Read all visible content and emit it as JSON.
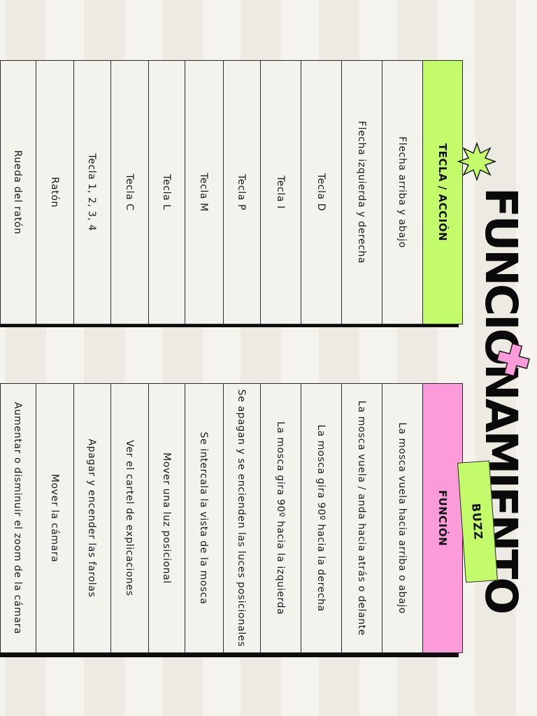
{
  "title": "FUNCIONAMIENTO",
  "tag": "BUZZ",
  "keys_table": {
    "header": "TECLA / ACCIÓN",
    "rows": [
      "Flecha arriba y abajo",
      "Flecha izquierda y derecha",
      "Tecla D",
      "Tecla I",
      "Tecla P",
      "Tecla M",
      "Tecla L",
      "Tecla C",
      "Tecla 1, 2, 3, 4",
      "Ratón",
      "Rueda del ratón"
    ]
  },
  "functions_table": {
    "header": "FUNCIÓN",
    "rows": [
      "La mosca vuela hacia arriba o abajo",
      "La mosca vuela / anda hacia atrás o delante",
      "La mosca gira 90º hacia la derecha",
      "La mosca gira 90º hacia la izquierda",
      "Se apagan y se encienden las luces posicionales",
      "Se intercala la vista de la mosca",
      "Mover una luz posicional",
      "Ver el cartel de explicaciones",
      "Apagar y encender las farolas",
      "Mover la cámara",
      "Aumentar o disminuir el zoom de la cámara"
    ]
  },
  "colors": {
    "background": "#f5f3ee",
    "green_accent": "#c3fb6b",
    "pink_accent": "#fb9bd9",
    "ink": "#0d0d0d"
  },
  "icons": [
    "star-burst-icon",
    "plus-cross-icon"
  ]
}
